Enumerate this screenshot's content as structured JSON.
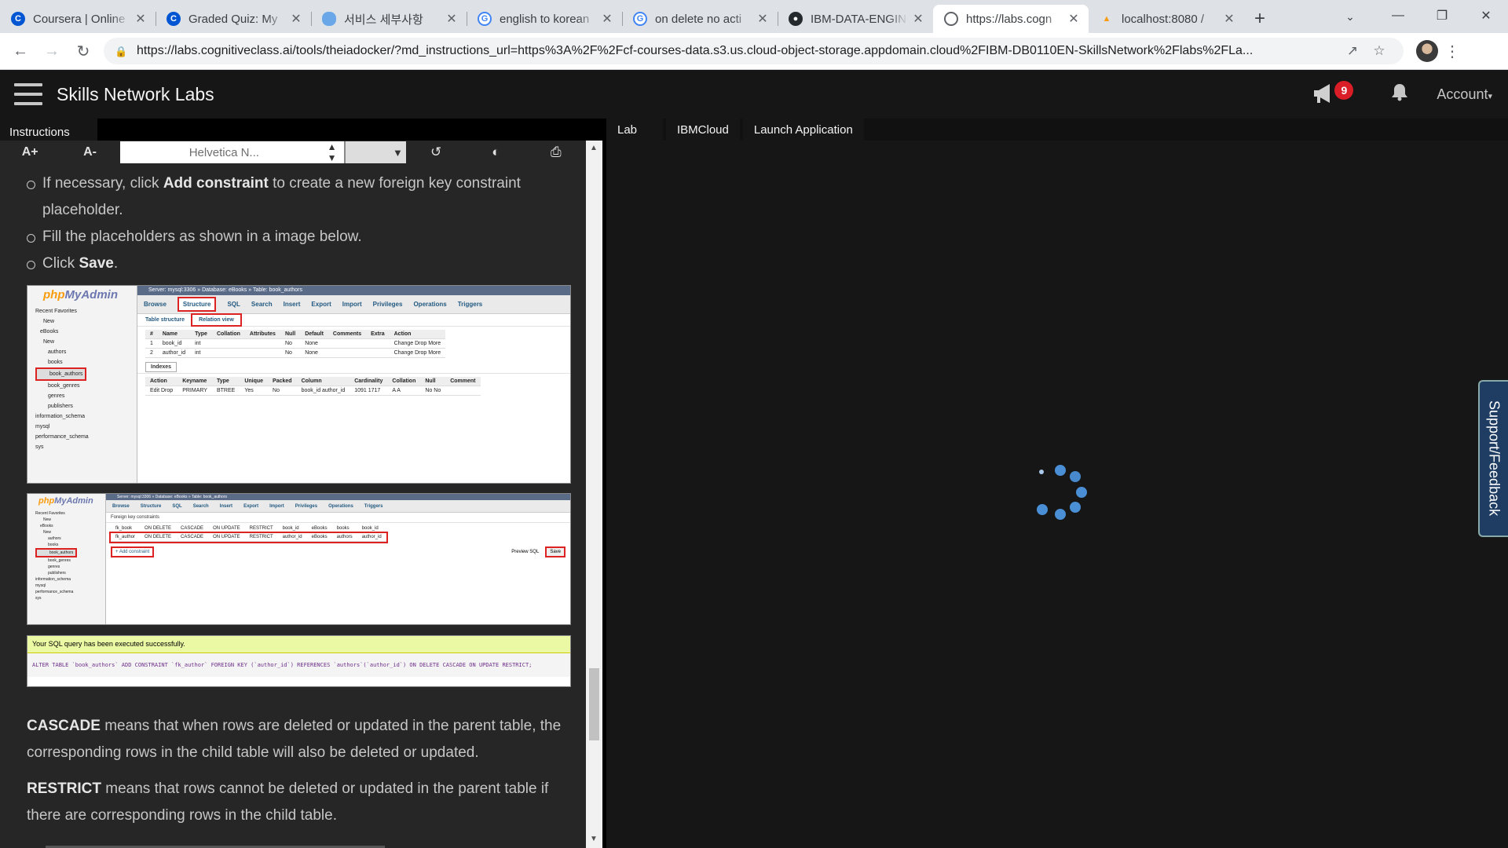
{
  "browser": {
    "tabs": [
      {
        "title": "Coursera | Online",
        "favicon": "coursera-icon",
        "color": "#0056d2"
      },
      {
        "title": "Graded Quiz: My",
        "favicon": "coursera-icon",
        "color": "#0056d2"
      },
      {
        "title": "서비스 세부사항",
        "favicon": "cloud-icon",
        "color": "#6aa7e8"
      },
      {
        "title": "english to korean",
        "favicon": "google-icon",
        "color": "#ffffff"
      },
      {
        "title": "on delete no acti",
        "favicon": "google-icon",
        "color": "#ffffff"
      },
      {
        "title": "IBM-DATA-ENGIN",
        "favicon": "github-icon",
        "color": "#24292e"
      },
      {
        "title": "https://labs.cogn",
        "favicon": "globe-icon",
        "color": "#5f6368",
        "active": true
      },
      {
        "title": "localhost:8080 / ",
        "favicon": "phpmyadmin-icon",
        "color": "#f89c0e"
      }
    ],
    "url": "https://labs.cognitiveclass.ai/tools/theiadocker/?md_instructions_url=https%3A%2F%2Fcf-courses-data.s3.us.cloud-object-storage.appdomain.cloud%2FIBM-DB0110EN-SkillsNetwork%2Flabs%2FLa..."
  },
  "app": {
    "brand": "Skills Network Labs",
    "notifications_count": "9",
    "account_label": "Account"
  },
  "instructions": {
    "tab_label": "Instructions",
    "toolbar": {
      "increase_font": "A+",
      "decrease_font": "A-",
      "font_family_value": "Helvetica N..."
    },
    "bullets": [
      {
        "pre": "If necessary, click ",
        "bold": "Add constraint",
        "post": " to create a new foreign key constraint placeholder."
      },
      {
        "pre": "Fill the placeholders as shown in a image below.",
        "bold": "",
        "post": ""
      },
      {
        "pre": "Click ",
        "bold": "Save",
        "post": "."
      }
    ],
    "paragraphs": [
      {
        "bold": "CASCADE",
        "text": " means that when rows are deleted or updated in the parent table, the corresponding rows in the child table will also be deleted or updated."
      },
      {
        "bold": "RESTRICT",
        "text": " means that rows cannot be deleted or updated in the parent table if there are corresponding rows in the child table."
      }
    ],
    "screenshot1": {
      "logo_a": "php",
      "logo_b": "MyAdmin",
      "breadcrumb": "Server: mysql:3306 » Database: eBooks » Table: book_authors",
      "tabs": [
        "Browse",
        "Structure",
        "SQL",
        "Search",
        "Insert",
        "Export",
        "Import",
        "Privileges",
        "Operations",
        "Triggers"
      ],
      "subtabs": [
        "Table structure",
        "Relation view"
      ],
      "tree": [
        "Recent  Favorites",
        "New",
        "eBooks",
        "New",
        "authors",
        "books",
        "book_authors",
        "book_genres",
        "genres",
        "publishers",
        "information_schema",
        "mysql",
        "performance_schema",
        "sys"
      ],
      "columns_header": [
        "#",
        "Name",
        "Type",
        "Collation",
        "Attributes",
        "Null",
        "Default",
        "Comments",
        "Extra",
        "Action"
      ],
      "rows": [
        [
          "1",
          "book_id",
          "int",
          "",
          "",
          "No",
          "None",
          "",
          "",
          "Change  Drop  More"
        ],
        [
          "2",
          "author_id",
          "int",
          "",
          "",
          "No",
          "None",
          "",
          "",
          "Change  Drop  More"
        ]
      ],
      "indexes_label": "Indexes",
      "index_header": [
        "Action",
        "Keyname",
        "Type",
        "Unique",
        "Packed",
        "Column",
        "Cardinality",
        "Collation",
        "Null",
        "Comment"
      ],
      "index_row": [
        "Edit  Drop",
        "PRIMARY",
        "BTREE",
        "Yes",
        "No",
        "book_id author_id",
        "1091 1717",
        "A A",
        "No No",
        ""
      ]
    },
    "screenshot2": {
      "section": "Foreign key constraints",
      "constraint_rows": [
        [
          "fk_book",
          "ON DELETE",
          "CASCADE",
          "ON UPDATE",
          "RESTRICT",
          "book_id",
          "eBooks",
          "books",
          "book_id"
        ],
        [
          "fk_author",
          "ON DELETE",
          "CASCADE",
          "ON UPDATE",
          "RESTRICT",
          "author_id",
          "eBooks",
          "authors",
          "author_id"
        ]
      ],
      "add_constraint": "+ Add constraint",
      "preview_sql": "Preview SQL",
      "save": "Save"
    },
    "screenshot3": {
      "message": "Your SQL query has been executed successfully.",
      "sql": "ALTER TABLE `book_authors` ADD CONSTRAINT `fk_author` FOREIGN KEY (`author_id`) REFERENCES `authors`(`author_id`) ON DELETE CASCADE ON UPDATE RESTRICT;"
    }
  },
  "lab": {
    "tabs": [
      "Lab",
      "IBMCloud",
      "Launch Application"
    ],
    "support_label": "Support/Feedback"
  }
}
